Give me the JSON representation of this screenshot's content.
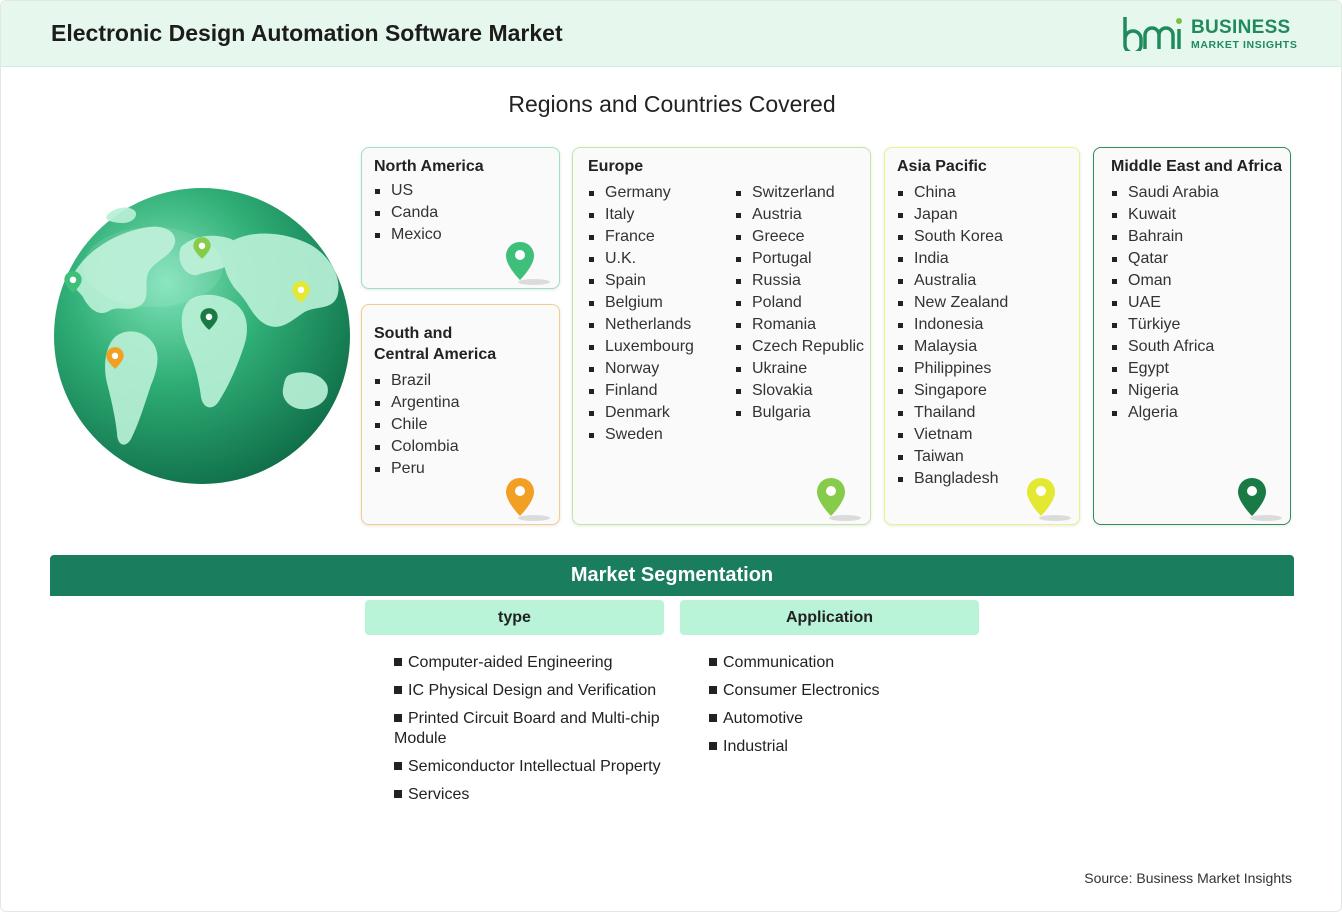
{
  "header": {
    "title": "Electronic Design Automation Software Market"
  },
  "logo": {
    "line1": "BUSINESS",
    "line2": "MARKET INSIGHTS",
    "color": "#1f8a5b"
  },
  "regions_title": "Regions and Countries Covered",
  "regions": {
    "north_america": {
      "title": "North America",
      "items": [
        "US",
        "Canda",
        "Mexico"
      ],
      "color": "#3ec07a"
    },
    "south_america": {
      "title_line1": "South and",
      "title_line2": "Central America",
      "items": [
        "Brazil",
        "Argentina",
        "Chile",
        "Colombia",
        "Peru"
      ],
      "color": "#f2a024"
    },
    "europe": {
      "title": "Europe",
      "col1": [
        "Germany",
        "Italy",
        "France",
        "U.K.",
        "Spain",
        "Belgium",
        "Netherlands",
        "Luxembourg",
        "Norway",
        "Finland",
        "Denmark",
        "Sweden"
      ],
      "col2": [
        "Switzerland",
        "Austria",
        "Greece",
        "Portugal",
        "Russia",
        "Poland",
        "Romania",
        "Czech Republic",
        "Ukraine",
        "Slovakia",
        "Bulgaria"
      ],
      "color": "#86cc4a"
    },
    "asia_pacific": {
      "title": "Asia Pacific",
      "items": [
        "China",
        "Japan",
        "South Korea",
        "India",
        "Australia",
        "New Zealand",
        "Indonesia",
        "Malaysia",
        "Philippines",
        "Singapore",
        "Thailand",
        "Vietnam",
        "Taiwan",
        "Bangladesh"
      ],
      "color": "#e3e832"
    },
    "mea": {
      "title": "Middle East and Africa",
      "items": [
        "Saudi Arabia",
        "Kuwait",
        "Bahrain",
        "Qatar",
        "Oman",
        "UAE",
        "Türkiye",
        "South Africa",
        "Egypt",
        "Nigeria",
        "Algeria"
      ],
      "color": "#1a7a46"
    }
  },
  "segmentation": {
    "title": "Market Segmentation",
    "type": {
      "label": "type",
      "items": [
        "Computer-aided Engineering",
        "IC Physical Design and Verification",
        "Printed Circuit Board and Multi-chip Module",
        "Semiconductor Intellectual Property",
        "Services"
      ]
    },
    "application": {
      "label": "Application",
      "items": [
        "Communication",
        "Consumer Electronics",
        "Automotive",
        "Industrial"
      ]
    }
  },
  "source": "Source: Business Market Insights"
}
